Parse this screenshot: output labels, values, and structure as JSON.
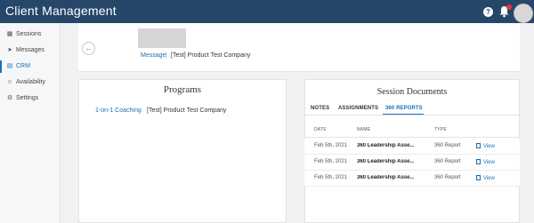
{
  "header": {
    "title": "Client Management",
    "help_icon": "question-circle-icon",
    "bell_icon": "bell-icon",
    "notification_icon": "red-dot",
    "accent": "#27476a"
  },
  "sidebar": {
    "items": [
      {
        "label": "Sessions",
        "icon": "calendar-icon",
        "active": false
      },
      {
        "label": "Messages",
        "icon": "paper-plane-icon",
        "active": false
      },
      {
        "label": "CRM",
        "icon": "clipboard-icon",
        "active": true
      },
      {
        "label": "Availability",
        "icon": "person-icon",
        "active": false
      },
      {
        "label": "Settings",
        "icon": "gear-icon",
        "active": false
      }
    ]
  },
  "client": {
    "message_label": "Message",
    "separator": "|",
    "company": "[Test] Product Test Company"
  },
  "programs": {
    "title": "Programs",
    "items": [
      {
        "name": "1-on-1 Coaching",
        "company": "[Test] Product Test Company"
      }
    ]
  },
  "documents": {
    "title": "Session Documents",
    "tabs": [
      {
        "label": "NOTES",
        "active": false
      },
      {
        "label": "ASSIGNMENTS",
        "active": false
      },
      {
        "label": "360 REPORTS",
        "active": true
      }
    ],
    "columns": [
      "DATE",
      "NAME",
      "TYPE"
    ],
    "rows": [
      {
        "date": "Feb 5th, 2021",
        "name": "360 Leadership Asse...",
        "type": "360 Report",
        "action": "View"
      },
      {
        "date": "Feb 5th, 2021",
        "name": "360 Leadership Asse...",
        "type": "360 Report",
        "action": "View"
      },
      {
        "date": "Feb 5th, 2021",
        "name": "360 Leadership Asse...",
        "type": "360 Report",
        "action": "View"
      }
    ]
  }
}
